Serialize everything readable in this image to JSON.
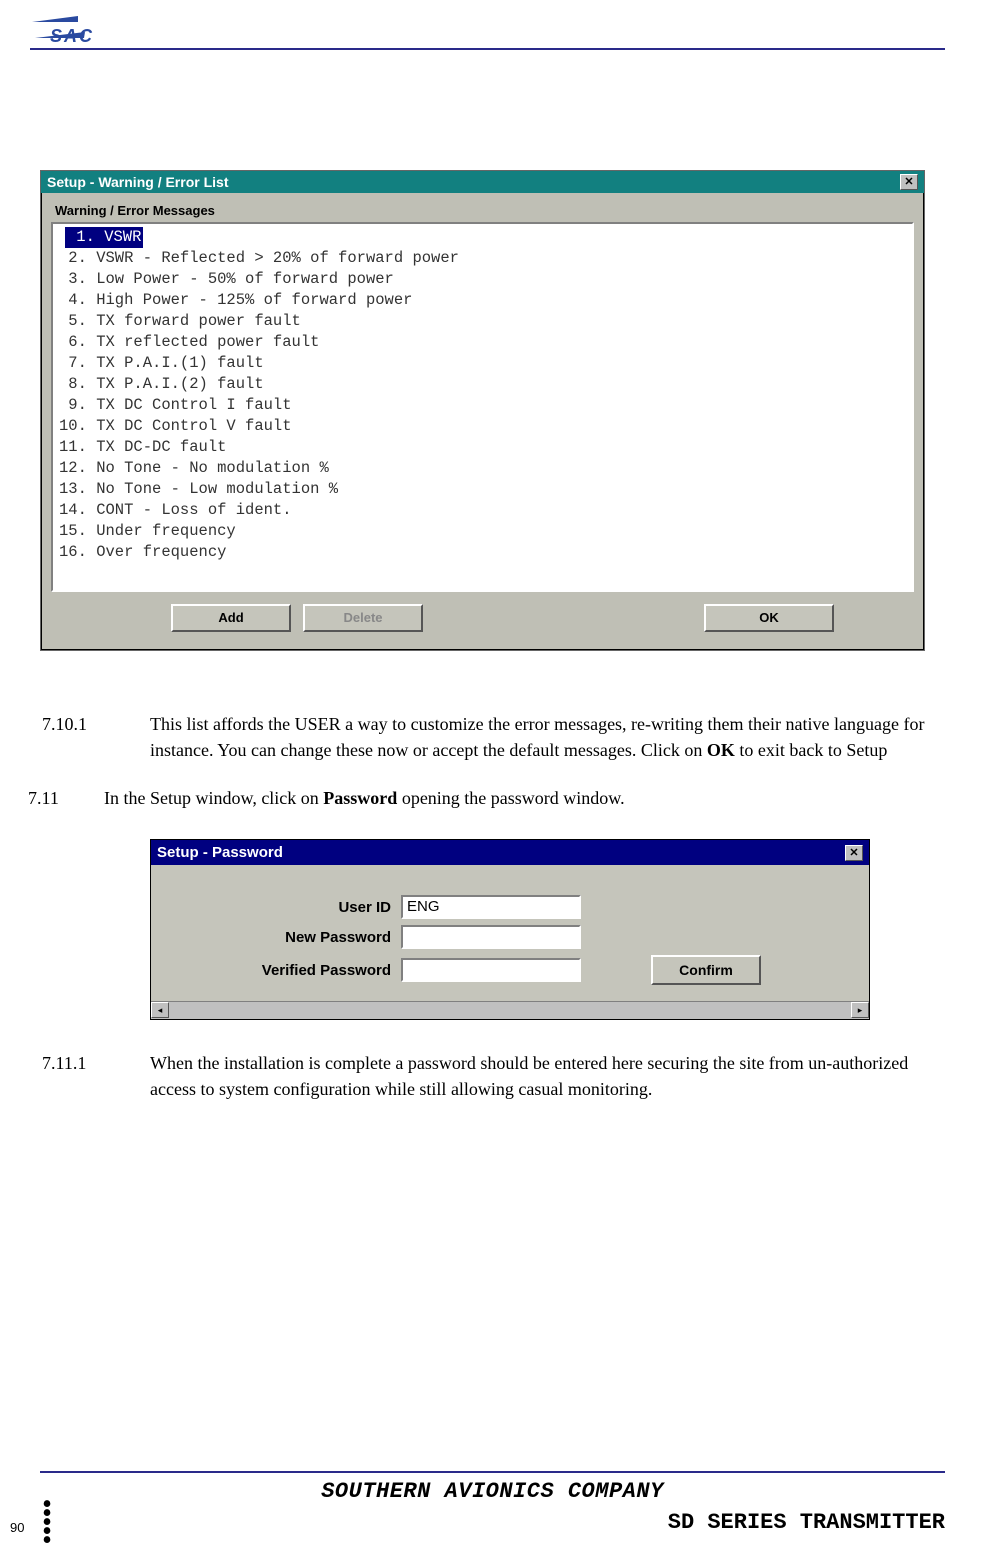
{
  "header": {},
  "dialog1": {
    "title": "Setup - Warning / Error List",
    "group_label": "Warning / Error Messages",
    "items": [
      " 1. VSWR",
      " 2. VSWR - Reflected > 20% of forward power",
      " 3. Low Power - 50% of forward power",
      " 4. High Power - 125% of forward power",
      " 5. TX forward power fault",
      " 6. TX reflected power fault",
      " 7. TX P.A.I.(1) fault",
      " 8. TX P.A.I.(2) fault",
      " 9. TX DC Control I fault",
      "10. TX DC Control V fault",
      "11. TX DC-DC fault",
      "12. No Tone - No modulation %",
      "13. No Tone - Low modulation %",
      "14. CONT - Loss of ident.",
      "15. Under frequency",
      "16. Over frequency"
    ],
    "buttons": {
      "add": "Add",
      "delete": "Delete",
      "ok": "OK"
    }
  },
  "para_7_10_1": {
    "num": "7.10.1",
    "text_a": "This list affords the USER a way to customize the error messages, re-writing them their native language for instance. You can change these now or accept the default messages. Click on ",
    "bold": "OK",
    "text_b": " to exit back to Setup"
  },
  "para_7_11": {
    "num": "7.11",
    "text_a": "In the Setup window, click on ",
    "bold": "Password",
    "text_b": " opening the password window."
  },
  "dialog2": {
    "title": "Setup - Password",
    "fields": {
      "user_id_label": "User ID",
      "user_id_value": "ENG",
      "new_pw_label": "New Password",
      "new_pw_value": "",
      "ver_pw_label": "Verified Password",
      "ver_pw_value": ""
    },
    "confirm": "Confirm"
  },
  "para_7_11_1": {
    "num": "7.11.1",
    "text": "When the installation is complete a password should be entered here securing the site from un-authorized access to system configuration while still allowing casual monitoring."
  },
  "footer": {
    "company": "SOUTHERN AVIONICS COMPANY",
    "product": "SD SERIES TRANSMITTER",
    "page": "90"
  }
}
